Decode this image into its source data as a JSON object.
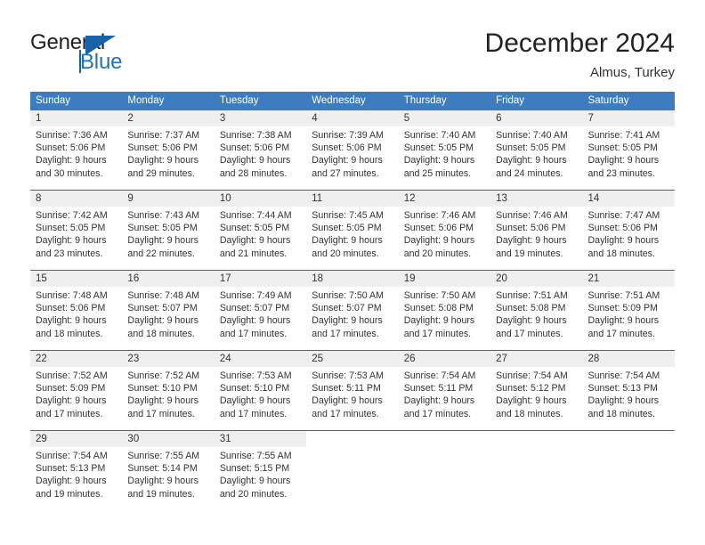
{
  "brand": {
    "name_part1": "General",
    "name_part2": "Blue",
    "logo_icon": "triangle-flag-icon",
    "accent_color": "#1763a8"
  },
  "header": {
    "month_title": "December 2024",
    "location": "Almus, Turkey"
  },
  "calendar": {
    "header_color": "#3c7cbf",
    "week_divider_color": "#2f6ca8",
    "day_band_color": "#efefef",
    "weekdays": [
      "Sunday",
      "Monday",
      "Tuesday",
      "Wednesday",
      "Thursday",
      "Friday",
      "Saturday"
    ],
    "weeks": [
      [
        {
          "day": "1",
          "sunrise": "Sunrise: 7:36 AM",
          "sunset": "Sunset: 5:06 PM",
          "daylight_line1": "Daylight: 9 hours",
          "daylight_line2": "and 30 minutes."
        },
        {
          "day": "2",
          "sunrise": "Sunrise: 7:37 AM",
          "sunset": "Sunset: 5:06 PM",
          "daylight_line1": "Daylight: 9 hours",
          "daylight_line2": "and 29 minutes."
        },
        {
          "day": "3",
          "sunrise": "Sunrise: 7:38 AM",
          "sunset": "Sunset: 5:06 PM",
          "daylight_line1": "Daylight: 9 hours",
          "daylight_line2": "and 28 minutes."
        },
        {
          "day": "4",
          "sunrise": "Sunrise: 7:39 AM",
          "sunset": "Sunset: 5:06 PM",
          "daylight_line1": "Daylight: 9 hours",
          "daylight_line2": "and 27 minutes."
        },
        {
          "day": "5",
          "sunrise": "Sunrise: 7:40 AM",
          "sunset": "Sunset: 5:05 PM",
          "daylight_line1": "Daylight: 9 hours",
          "daylight_line2": "and 25 minutes."
        },
        {
          "day": "6",
          "sunrise": "Sunrise: 7:40 AM",
          "sunset": "Sunset: 5:05 PM",
          "daylight_line1": "Daylight: 9 hours",
          "daylight_line2": "and 24 minutes."
        },
        {
          "day": "7",
          "sunrise": "Sunrise: 7:41 AM",
          "sunset": "Sunset: 5:05 PM",
          "daylight_line1": "Daylight: 9 hours",
          "daylight_line2": "and 23 minutes."
        }
      ],
      [
        {
          "day": "8",
          "sunrise": "Sunrise: 7:42 AM",
          "sunset": "Sunset: 5:05 PM",
          "daylight_line1": "Daylight: 9 hours",
          "daylight_line2": "and 23 minutes."
        },
        {
          "day": "9",
          "sunrise": "Sunrise: 7:43 AM",
          "sunset": "Sunset: 5:05 PM",
          "daylight_line1": "Daylight: 9 hours",
          "daylight_line2": "and 22 minutes."
        },
        {
          "day": "10",
          "sunrise": "Sunrise: 7:44 AM",
          "sunset": "Sunset: 5:05 PM",
          "daylight_line1": "Daylight: 9 hours",
          "daylight_line2": "and 21 minutes."
        },
        {
          "day": "11",
          "sunrise": "Sunrise: 7:45 AM",
          "sunset": "Sunset: 5:05 PM",
          "daylight_line1": "Daylight: 9 hours",
          "daylight_line2": "and 20 minutes."
        },
        {
          "day": "12",
          "sunrise": "Sunrise: 7:46 AM",
          "sunset": "Sunset: 5:06 PM",
          "daylight_line1": "Daylight: 9 hours",
          "daylight_line2": "and 20 minutes."
        },
        {
          "day": "13",
          "sunrise": "Sunrise: 7:46 AM",
          "sunset": "Sunset: 5:06 PM",
          "daylight_line1": "Daylight: 9 hours",
          "daylight_line2": "and 19 minutes."
        },
        {
          "day": "14",
          "sunrise": "Sunrise: 7:47 AM",
          "sunset": "Sunset: 5:06 PM",
          "daylight_line1": "Daylight: 9 hours",
          "daylight_line2": "and 18 minutes."
        }
      ],
      [
        {
          "day": "15",
          "sunrise": "Sunrise: 7:48 AM",
          "sunset": "Sunset: 5:06 PM",
          "daylight_line1": "Daylight: 9 hours",
          "daylight_line2": "and 18 minutes."
        },
        {
          "day": "16",
          "sunrise": "Sunrise: 7:48 AM",
          "sunset": "Sunset: 5:07 PM",
          "daylight_line1": "Daylight: 9 hours",
          "daylight_line2": "and 18 minutes."
        },
        {
          "day": "17",
          "sunrise": "Sunrise: 7:49 AM",
          "sunset": "Sunset: 5:07 PM",
          "daylight_line1": "Daylight: 9 hours",
          "daylight_line2": "and 17 minutes."
        },
        {
          "day": "18",
          "sunrise": "Sunrise: 7:50 AM",
          "sunset": "Sunset: 5:07 PM",
          "daylight_line1": "Daylight: 9 hours",
          "daylight_line2": "and 17 minutes."
        },
        {
          "day": "19",
          "sunrise": "Sunrise: 7:50 AM",
          "sunset": "Sunset: 5:08 PM",
          "daylight_line1": "Daylight: 9 hours",
          "daylight_line2": "and 17 minutes."
        },
        {
          "day": "20",
          "sunrise": "Sunrise: 7:51 AM",
          "sunset": "Sunset: 5:08 PM",
          "daylight_line1": "Daylight: 9 hours",
          "daylight_line2": "and 17 minutes."
        },
        {
          "day": "21",
          "sunrise": "Sunrise: 7:51 AM",
          "sunset": "Sunset: 5:09 PM",
          "daylight_line1": "Daylight: 9 hours",
          "daylight_line2": "and 17 minutes."
        }
      ],
      [
        {
          "day": "22",
          "sunrise": "Sunrise: 7:52 AM",
          "sunset": "Sunset: 5:09 PM",
          "daylight_line1": "Daylight: 9 hours",
          "daylight_line2": "and 17 minutes."
        },
        {
          "day": "23",
          "sunrise": "Sunrise: 7:52 AM",
          "sunset": "Sunset: 5:10 PM",
          "daylight_line1": "Daylight: 9 hours",
          "daylight_line2": "and 17 minutes."
        },
        {
          "day": "24",
          "sunrise": "Sunrise: 7:53 AM",
          "sunset": "Sunset: 5:10 PM",
          "daylight_line1": "Daylight: 9 hours",
          "daylight_line2": "and 17 minutes."
        },
        {
          "day": "25",
          "sunrise": "Sunrise: 7:53 AM",
          "sunset": "Sunset: 5:11 PM",
          "daylight_line1": "Daylight: 9 hours",
          "daylight_line2": "and 17 minutes."
        },
        {
          "day": "26",
          "sunrise": "Sunrise: 7:54 AM",
          "sunset": "Sunset: 5:11 PM",
          "daylight_line1": "Daylight: 9 hours",
          "daylight_line2": "and 17 minutes."
        },
        {
          "day": "27",
          "sunrise": "Sunrise: 7:54 AM",
          "sunset": "Sunset: 5:12 PM",
          "daylight_line1": "Daylight: 9 hours",
          "daylight_line2": "and 18 minutes."
        },
        {
          "day": "28",
          "sunrise": "Sunrise: 7:54 AM",
          "sunset": "Sunset: 5:13 PM",
          "daylight_line1": "Daylight: 9 hours",
          "daylight_line2": "and 18 minutes."
        }
      ],
      [
        {
          "day": "29",
          "sunrise": "Sunrise: 7:54 AM",
          "sunset": "Sunset: 5:13 PM",
          "daylight_line1": "Daylight: 9 hours",
          "daylight_line2": "and 19 minutes."
        },
        {
          "day": "30",
          "sunrise": "Sunrise: 7:55 AM",
          "sunset": "Sunset: 5:14 PM",
          "daylight_line1": "Daylight: 9 hours",
          "daylight_line2": "and 19 minutes."
        },
        {
          "day": "31",
          "sunrise": "Sunrise: 7:55 AM",
          "sunset": "Sunset: 5:15 PM",
          "daylight_line1": "Daylight: 9 hours",
          "daylight_line2": "and 20 minutes."
        },
        {
          "day": "",
          "sunrise": "",
          "sunset": "",
          "daylight_line1": "",
          "daylight_line2": ""
        },
        {
          "day": "",
          "sunrise": "",
          "sunset": "",
          "daylight_line1": "",
          "daylight_line2": ""
        },
        {
          "day": "",
          "sunrise": "",
          "sunset": "",
          "daylight_line1": "",
          "daylight_line2": ""
        },
        {
          "day": "",
          "sunrise": "",
          "sunset": "",
          "daylight_line1": "",
          "daylight_line2": ""
        }
      ]
    ]
  }
}
